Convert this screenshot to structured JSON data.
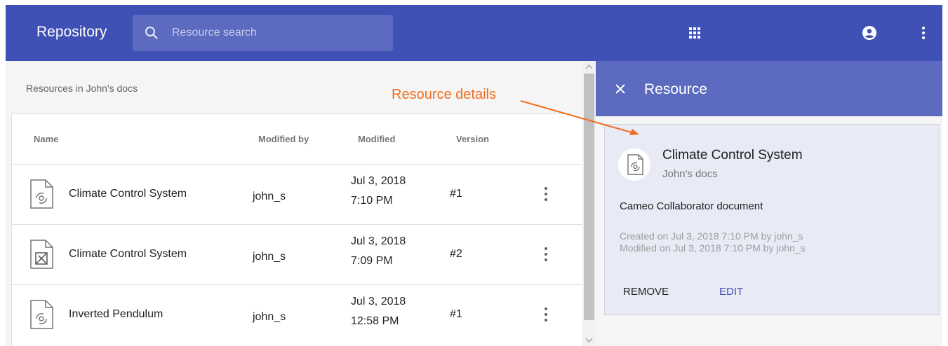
{
  "header": {
    "title": "Repository",
    "search_placeholder": "Resource search",
    "icons": [
      "apps-grid-icon",
      "account-circle-icon",
      "more-vert-icon"
    ]
  },
  "list": {
    "section_title": "Resources in John's docs",
    "columns": {
      "name": "Name",
      "modified_by": "Modified by",
      "modified": "Modified",
      "version": "Version"
    },
    "rows": [
      {
        "icon": "collaborator-document-icon",
        "name": "Climate Control System",
        "modified_by": "john_s",
        "date": "Jul 3, 2018",
        "time": "7:10 PM",
        "version": "#1"
      },
      {
        "icon": "diagram-document-icon",
        "name": "Climate Control System",
        "modified_by": "john_s",
        "date": "Jul 3, 2018",
        "time": "7:09 PM",
        "version": "#2"
      },
      {
        "icon": "collaborator-document-icon",
        "name": "Inverted Pendulum",
        "modified_by": "john_s",
        "date": "Jul 3, 2018",
        "time": "12:58 PM",
        "version": "#1"
      }
    ]
  },
  "details": {
    "header_title": "Resource",
    "resource_name": "Climate Control System",
    "location": "John's docs",
    "type": "Cameo Collaborator document",
    "created": "Created on Jul 3, 2018 7:10 PM by john_s",
    "modified": "Modified on Jul 3, 2018 7:10 PM by john_s",
    "remove_label": "REMOVE",
    "edit_label": "EDIT"
  },
  "annotation": {
    "label": "Resource details"
  },
  "colors": {
    "primary": "#3f51b5",
    "primary_light": "#5c6bc0",
    "card_bg": "#e8eaf6",
    "annotation": "#f26b1d",
    "edit_button": "#3f51b5"
  }
}
